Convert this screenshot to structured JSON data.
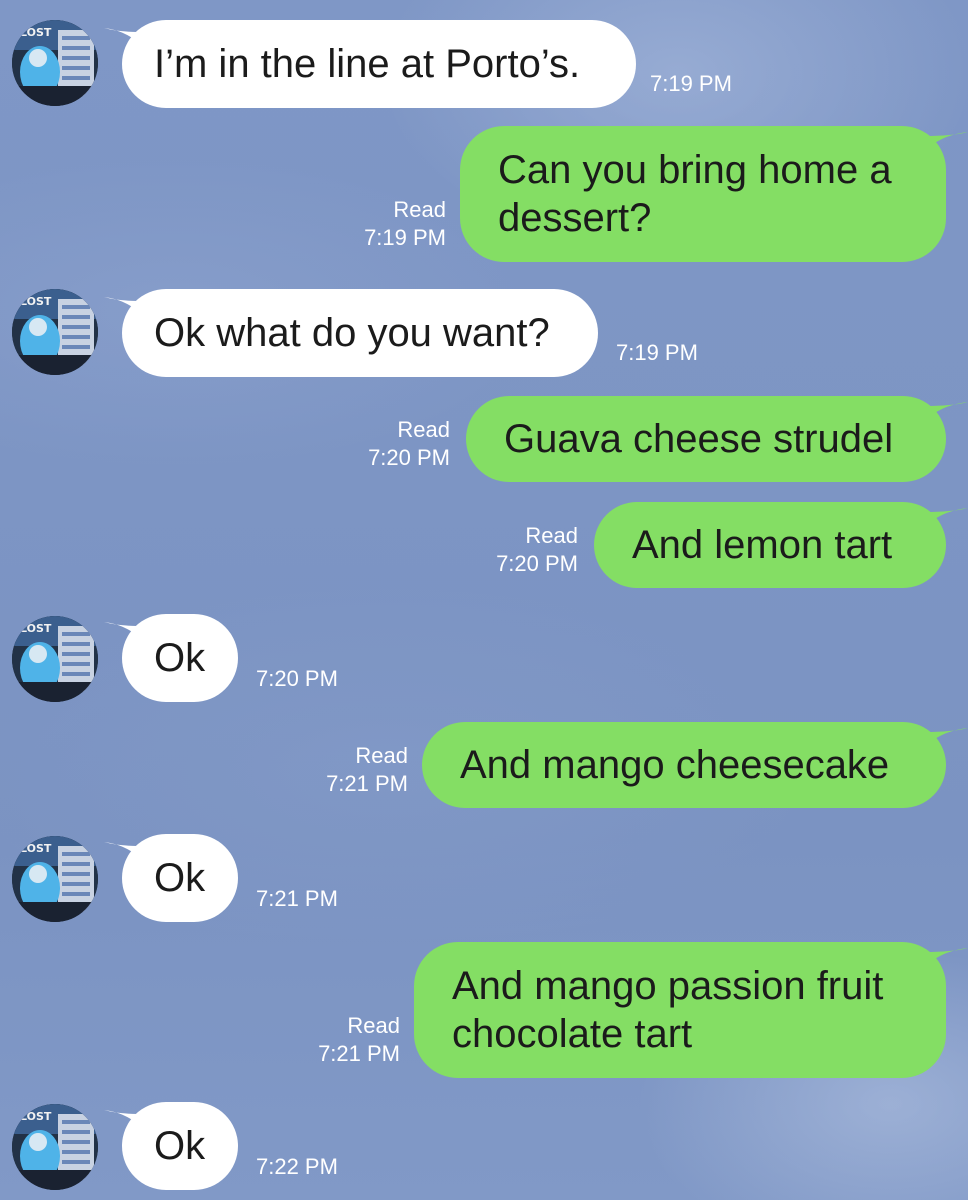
{
  "conversation": {
    "messages": [
      {
        "direction": "incoming",
        "text": "I’m in the line at Porto’s.",
        "time": "7:19 PM"
      },
      {
        "direction": "outgoing",
        "lines": [
          "Can you bring home a",
          "dessert?"
        ],
        "read_label": "Read",
        "time": "7:19 PM"
      },
      {
        "direction": "incoming",
        "text": "Ok what do you want?",
        "time": "7:19 PM"
      },
      {
        "direction": "outgoing",
        "text": "Guava cheese strudel",
        "read_label": "Read",
        "time": "7:20 PM"
      },
      {
        "direction": "outgoing",
        "text": "And lemon tart",
        "read_label": "Read",
        "time": "7:20 PM"
      },
      {
        "direction": "incoming",
        "text": "Ok",
        "time": "7:20 PM"
      },
      {
        "direction": "outgoing",
        "text": "And mango cheesecake",
        "read_label": "Read",
        "time": "7:21 PM"
      },
      {
        "direction": "incoming",
        "text": "Ok",
        "time": "7:21 PM"
      },
      {
        "direction": "outgoing",
        "lines": [
          "And mango passion fruit",
          "chocolate tart"
        ],
        "read_label": "Read",
        "time": "7:21 PM"
      },
      {
        "direction": "incoming",
        "text": "Ok",
        "time": "7:22 PM"
      }
    ]
  },
  "avatar": {
    "icon": "contact-avatar-icon",
    "badge_text": "LOST"
  },
  "colors": {
    "outgoing_bubble": "#84de64",
    "incoming_bubble": "#ffffff",
    "background": "#7f97c6",
    "meta_text": "#ffffff"
  }
}
